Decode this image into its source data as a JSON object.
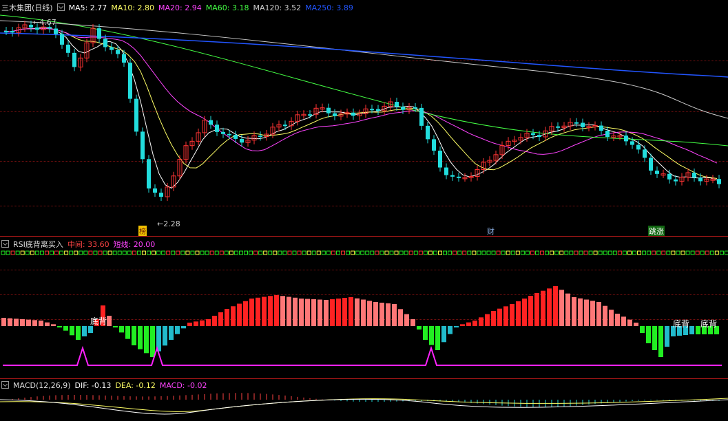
{
  "main": {
    "title": "三木集团(日线)",
    "ma": [
      {
        "label": "MA5: 2.77",
        "color": "#ffffff"
      },
      {
        "label": "MA10: 2.80",
        "color": "#ffff66"
      },
      {
        "label": "MA20: 2.94",
        "color": "#ff44ff"
      },
      {
        "label": "MA60: 3.18",
        "color": "#44ff44"
      },
      {
        "label": "MA120: 3.52",
        "color": "#cccccc"
      },
      {
        "label": "MA250: 3.89",
        "color": "#2255ff"
      }
    ],
    "high_label": "4.67",
    "low_label": "2.28",
    "event_tags": [
      "榜",
      "财",
      "跳涨"
    ]
  },
  "rsi": {
    "title": "RSI底背离买入",
    "mid_label": "中间: 33.60",
    "short_label": "短线: 20.00",
    "signal_text": [
      "底背",
      "底背",
      "底背"
    ]
  },
  "macd": {
    "title": "MACD(12,26,9)",
    "dif_label": "DIF: -0.13",
    "dea_label": "DEA: -0.12",
    "macd_label": "MACD: -0.02"
  },
  "colors": {
    "up": "#ff3333",
    "down": "#22dddd",
    "rsi_green": "#22ee22",
    "rsi_red": "#ff2222",
    "rsi_pink": "#ff7777",
    "rsi_cyan": "#22bbcc",
    "magenta": "#ff22ff"
  }
}
